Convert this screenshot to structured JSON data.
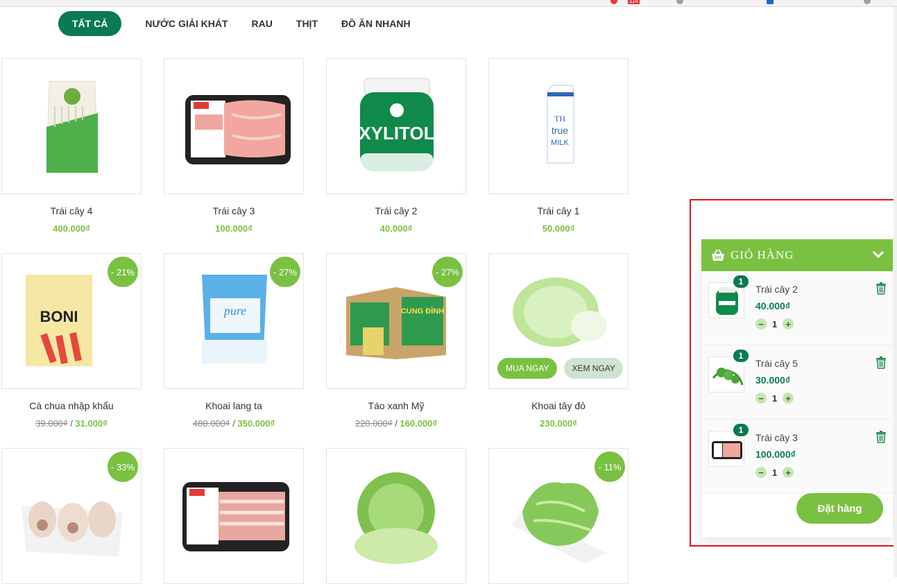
{
  "browser": {
    "ext_badge": "114"
  },
  "tabs": [
    {
      "label": "TẤT CẢ",
      "active": true
    },
    {
      "label": "NƯỚC GIẢI KHÁT"
    },
    {
      "label": "RAU"
    },
    {
      "label": "THỊT"
    },
    {
      "label": "ĐỒ ĂN NHANH"
    }
  ],
  "products": [
    {
      "name": "Trái cây 4",
      "price": "400.000₫",
      "image": "enoki-mushroom-pack"
    },
    {
      "name": "Trái cây 3",
      "price": "100.000₫",
      "image": "meat-tray"
    },
    {
      "name": "Trái cây 2",
      "price": "40.000₫",
      "image": "xylitol-jar",
      "jar_text": "XYLITOL"
    },
    {
      "name": "Trái cây 1",
      "price": "50.000₫",
      "image": "milk-carton",
      "carton_text": [
        "TH",
        "true",
        "MILK"
      ]
    },
    {
      "name": "Cà chua nhập khẩu",
      "old_price": "39.000₫",
      "price": "31.000₫",
      "discount": "- 21%",
      "image": "snack-bag",
      "bag_text": "BONI"
    },
    {
      "name": "Khoai lang ta",
      "old_price": "480.000₫",
      "price": "350.000₫",
      "discount": "- 27%",
      "image": "sugar-bag",
      "bag_text": "pure"
    },
    {
      "name": "Táo xanh Mỹ",
      "old_price": "220.000₫",
      "price": "160.000₫",
      "discount": "- 27%",
      "image": "noodle-box",
      "box_text": "CUNG ĐÌNH"
    },
    {
      "name": "Khoai tây đỏ",
      "price": "230.000₫",
      "image": "cabbage",
      "buy_label": "MUA NGAY",
      "view_label": "XEM NGAY"
    },
    {
      "name": "",
      "price": "",
      "discount": "- 33%",
      "image": "pork-legs"
    },
    {
      "name": "",
      "price": "",
      "image": "bacon-tray"
    },
    {
      "name": "",
      "price": "",
      "image": "cabbage-green"
    },
    {
      "name": "",
      "price": "",
      "discount": "- 11%",
      "image": "lettuce"
    }
  ],
  "cart": {
    "title": "GIỎ HÀNG",
    "items": [
      {
        "qty_badge": "1",
        "name": "Trái cây 2",
        "price": "40.000₫",
        "qty": "1",
        "image": "xylitol-jar"
      },
      {
        "qty_badge": "1",
        "name": "Trái cây 5",
        "price": "30.000₫",
        "qty": "1",
        "image": "greens"
      },
      {
        "qty_badge": "1",
        "name": "Trái cây 3",
        "price": "100.000₫",
        "qty": "1",
        "image": "meat-tray"
      }
    ],
    "minus": "−",
    "plus": "+",
    "order_label": "Đặt hàng"
  },
  "colors": {
    "brand_green": "#7ac142",
    "dark_green": "#0a7a52",
    "highlight_red": "#e0151b"
  }
}
